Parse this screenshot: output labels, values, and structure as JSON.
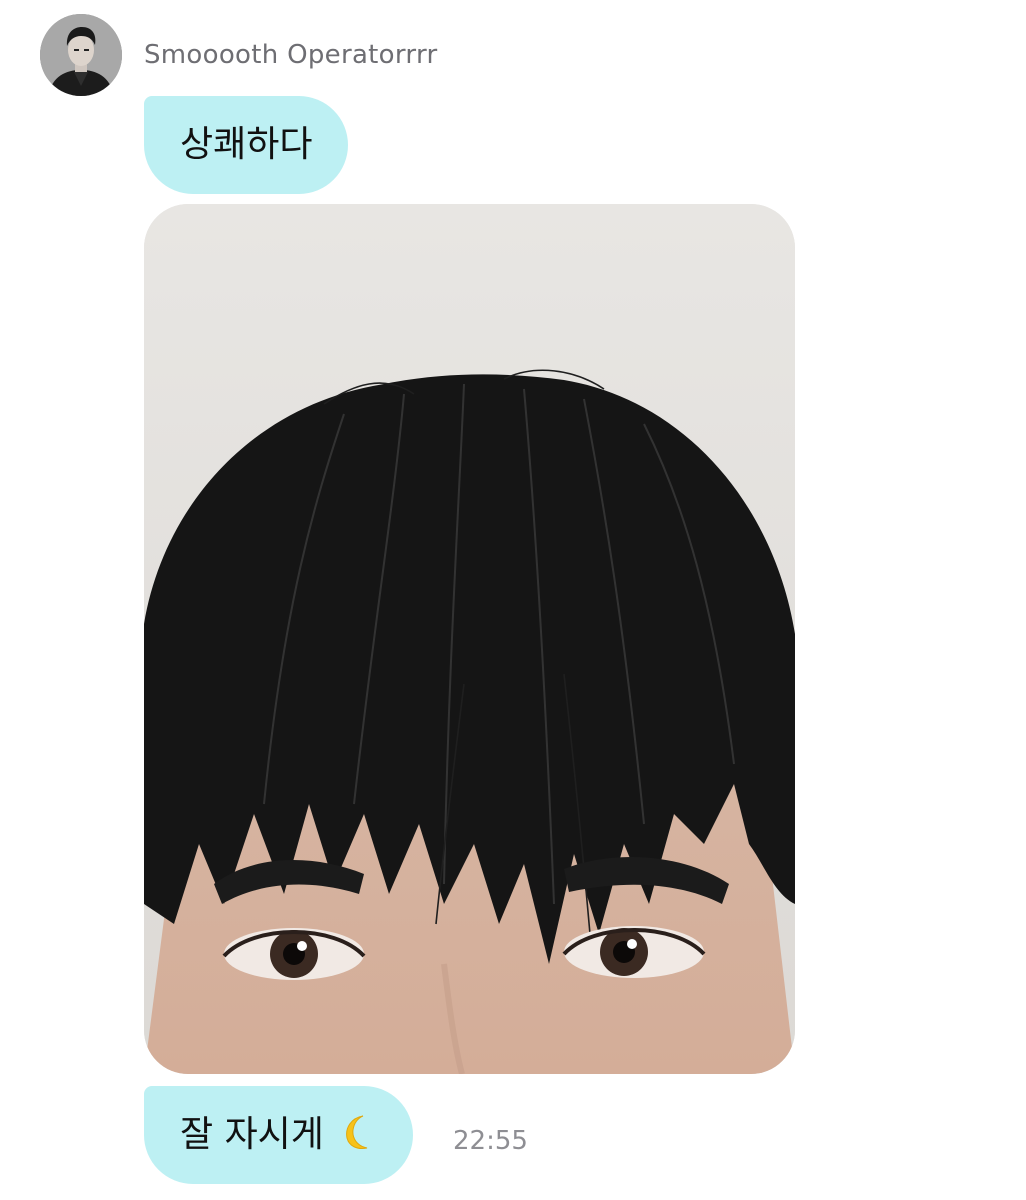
{
  "sender": {
    "name": "Smooooth Operatorrrr",
    "avatar_icon": "profile-photo"
  },
  "messages": [
    {
      "type": "text",
      "text": "상쾌하다"
    },
    {
      "type": "image",
      "subject": "selfie-photo"
    },
    {
      "type": "text",
      "text": "잘 자시게",
      "emoji": "crescent-moon-icon"
    }
  ],
  "last_timestamp": "22:55",
  "colors": {
    "bubble": "#bdf0f3",
    "name_text": "#6e6e73",
    "time_text": "#8e8e93"
  }
}
